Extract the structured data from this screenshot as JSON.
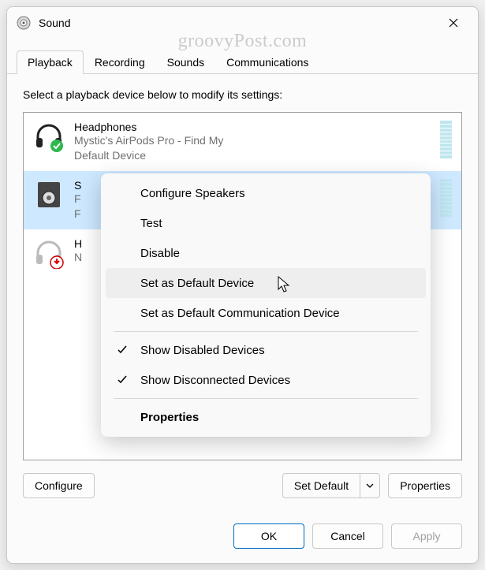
{
  "window": {
    "title": "Sound",
    "watermark": "groovyPost.com"
  },
  "tabs": [
    {
      "label": "Playback",
      "active": true
    },
    {
      "label": "Recording",
      "active": false
    },
    {
      "label": "Sounds",
      "active": false
    },
    {
      "label": "Communications",
      "active": false
    }
  ],
  "instruction": "Select a playback device below to modify its settings:",
  "devices": [
    {
      "name": "Headphones",
      "sub1": "Mystic's AirPods Pro - Find My",
      "sub2": "Default Device",
      "icon": "headphones-check",
      "selected": false
    },
    {
      "name": "S",
      "sub1": "F",
      "sub2": "F",
      "icon": "speaker",
      "selected": true
    },
    {
      "name": "H",
      "sub1": "N",
      "sub2": "",
      "icon": "headphones-down",
      "selected": false
    }
  ],
  "buttons": {
    "configure": "Configure",
    "set_default": "Set Default",
    "properties": "Properties",
    "ok": "OK",
    "cancel": "Cancel",
    "apply": "Apply"
  },
  "context_menu": {
    "items": [
      {
        "label": "Configure Speakers",
        "checked": false
      },
      {
        "label": "Test",
        "checked": false
      },
      {
        "label": "Disable",
        "checked": false
      },
      {
        "label": "Set as Default Device",
        "checked": false,
        "hover": true
      },
      {
        "label": "Set as Default Communication Device",
        "checked": false
      },
      {
        "sep": true
      },
      {
        "label": "Show Disabled Devices",
        "checked": true
      },
      {
        "label": "Show Disconnected Devices",
        "checked": true
      },
      {
        "sep": true
      },
      {
        "label": "Properties",
        "checked": false,
        "bold": true
      }
    ]
  }
}
